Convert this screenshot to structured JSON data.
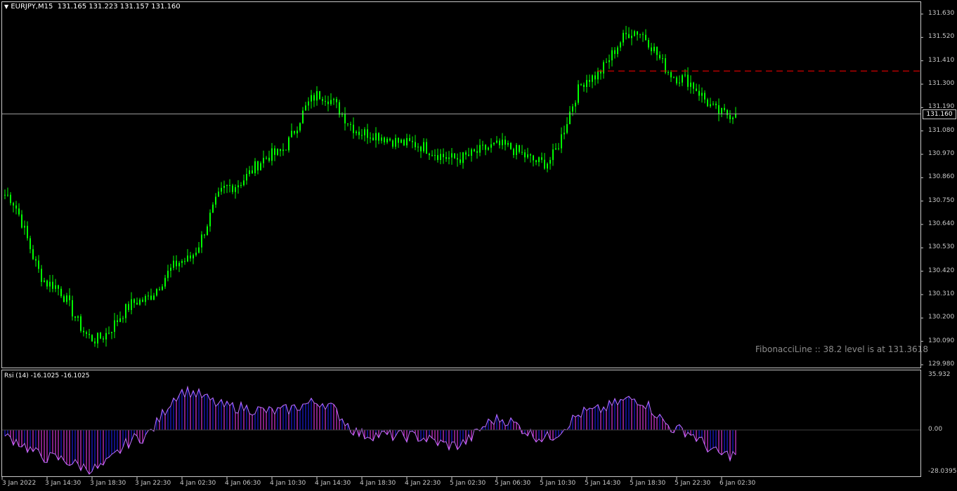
{
  "header": {
    "symbol_label": "EURJPY,M15",
    "ohlc": "131.165 131.223 131.157 131.160"
  },
  "price_axis": {
    "ticks": [
      "131.630",
      "131.520",
      "131.410",
      "131.300",
      "131.190",
      "131.080",
      "130.970",
      "130.860",
      "130.750",
      "130.640",
      "130.530",
      "130.420",
      "130.310",
      "130.200",
      "130.090",
      "129.980"
    ],
    "current_tag": "131.160"
  },
  "fibonacci_note": "FibonacciLine :: 38.2 level is at 131.3618",
  "indicator": {
    "label": "Rsi (14) -16.1025 -16.1025",
    "ticks": [
      "35.932",
      "0.00",
      "-28.0395"
    ]
  },
  "time_axis": {
    "labels": [
      "3 Jan 2022",
      "3 Jan 14:30",
      "3 Jan 18:30",
      "3 Jan 22:30",
      "4 Jan 02:30",
      "4 Jan 06:30",
      "4 Jan 10:30",
      "4 Jan 14:30",
      "4 Jan 18:30",
      "4 Jan 22:30",
      "5 Jan 02:30",
      "5 Jan 06:30",
      "5 Jan 10:30",
      "5 Jan 14:30",
      "5 Jan 18:30",
      "5 Jan 22:30",
      "6 Jan 02:30"
    ]
  },
  "colors": {
    "background": "#000000",
    "candle": "#00ff00",
    "bid_line": "#a0a0a0",
    "fib_line": "#d00000",
    "rsi_up": "#2020ff",
    "rsi_down": "#ff40ff"
  },
  "chart_data": [
    {
      "type": "line",
      "title": "EURJPY,M15",
      "series": [
        {
          "name": "EURJPY",
          "x": [
            "3 Jan 2022",
            "3 Jan 14:30",
            "3 Jan 18:30",
            "3 Jan 22:30",
            "4 Jan 02:30",
            "4 Jan 06:30",
            "4 Jan 10:30",
            "4 Jan 14:30",
            "4 Jan 18:30",
            "4 Jan 22:30",
            "5 Jan 02:30",
            "5 Jan 06:30",
            "5 Jan 10:30",
            "5 Jan 14:30",
            "5 Jan 18:30",
            "5 Jan 22:30",
            "6 Jan 02:30"
          ],
          "values": [
            130.78,
            130.36,
            130.1,
            130.28,
            130.47,
            130.82,
            130.97,
            131.25,
            131.07,
            131.02,
            130.95,
            131.01,
            130.93,
            131.33,
            131.55,
            131.33,
            131.16
          ]
        }
      ],
      "ylim": [
        129.95,
        131.66
      ],
      "price_lines": {
        "bid": 131.16,
        "fibonacci_38_2": 131.3618
      }
    },
    {
      "type": "line",
      "title": "Rsi (14) -16.1025 -16.1025",
      "series": [
        {
          "name": "Rsi (14)",
          "x": [
            "3 Jan 2022",
            "3 Jan 14:30",
            "3 Jan 18:30",
            "3 Jan 22:30",
            "4 Jan 02:30",
            "4 Jan 06:30",
            "4 Jan 10:30",
            "4 Jan 14:30",
            "4 Jan 18:30",
            "4 Jan 22:30",
            "5 Jan 02:30",
            "5 Jan 06:30",
            "5 Jan 10:30",
            "5 Jan 14:30",
            "5 Jan 18:30",
            "5 Jan 22:30",
            "6 Jan 02:30"
          ],
          "values": [
            -5,
            -18,
            -25,
            -5,
            25,
            15,
            12,
            18,
            -3,
            -4,
            -10,
            7,
            -5,
            12,
            20,
            0,
            -16.1025
          ]
        }
      ],
      "ylim": [
        -28.0395,
        35.932
      ]
    }
  ]
}
